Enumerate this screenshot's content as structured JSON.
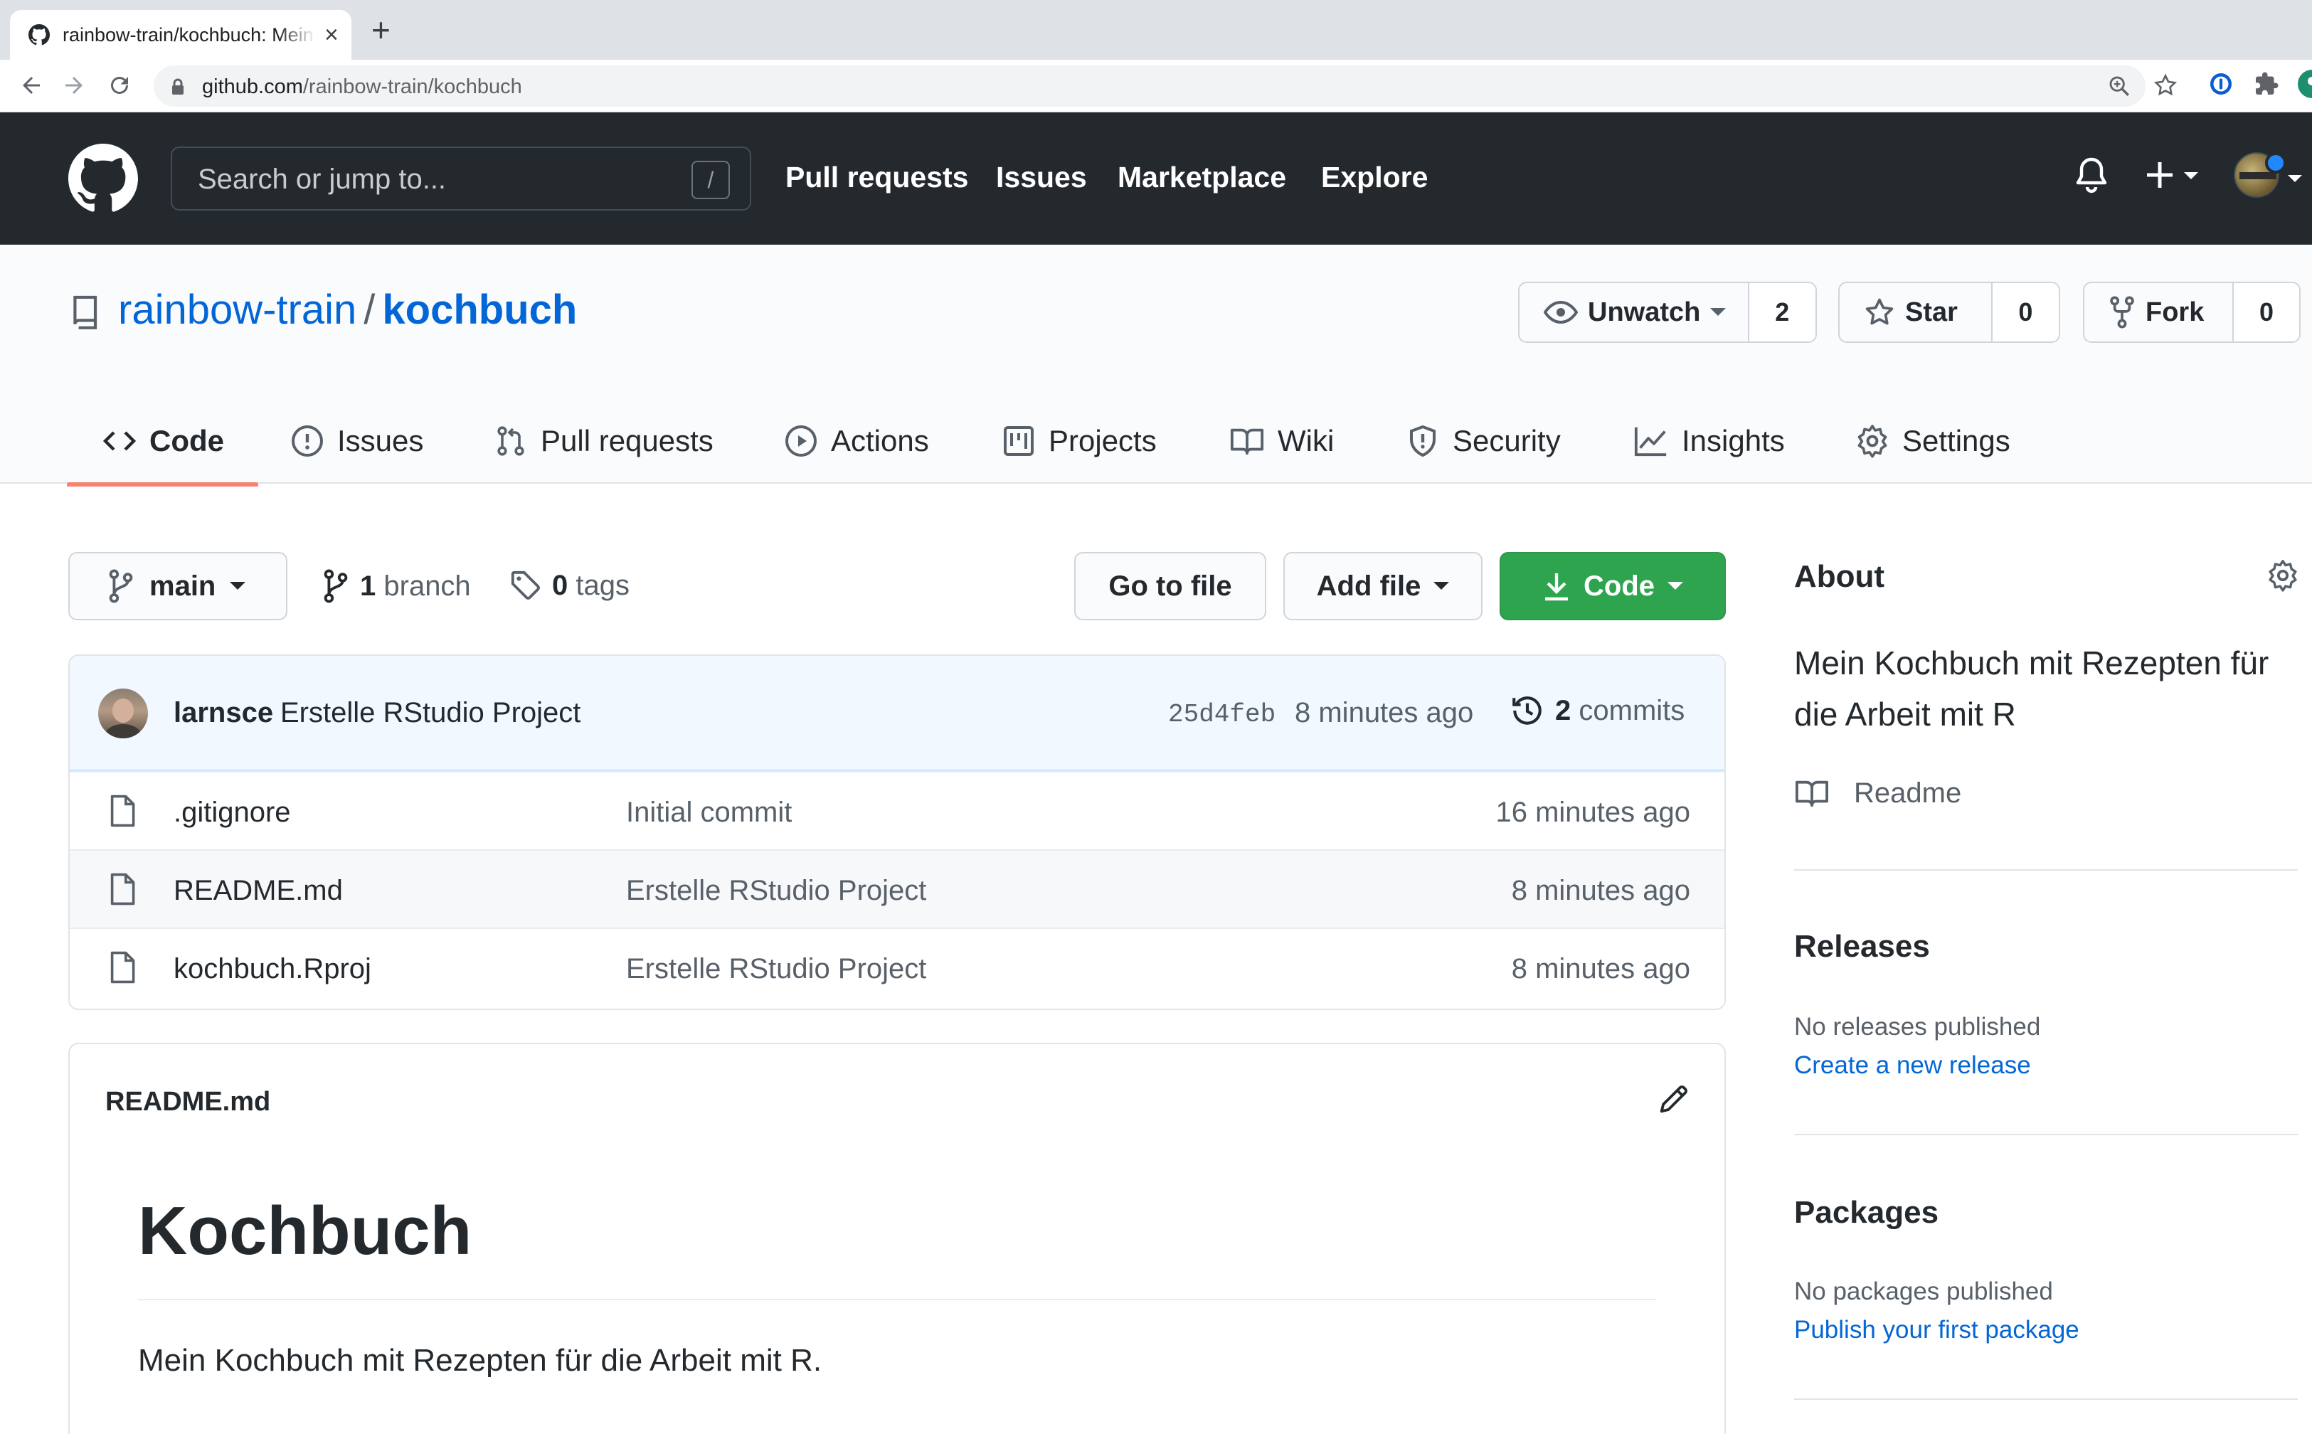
{
  "browser": {
    "tab_title": "rainbow-train/kochbuch: Mein Kochbuch mit Rezepten für die Arbeit mit R",
    "url_host": "github.com",
    "url_path": "/rainbow-train/kochbuch"
  },
  "header": {
    "search_placeholder": "Search or jump to...",
    "search_shortcut": "/",
    "nav": [
      "Pull requests",
      "Issues",
      "Marketplace",
      "Explore"
    ]
  },
  "repo": {
    "owner": "rainbow-train",
    "separator": "/",
    "name": "kochbuch",
    "watch_label": "Unwatch",
    "watch_count": "2",
    "star_label": "Star",
    "star_count": "0",
    "fork_label": "Fork",
    "fork_count": "0"
  },
  "tabs": [
    {
      "label": "Code",
      "icon": "code-icon",
      "selected": true
    },
    {
      "label": "Issues",
      "icon": "issue-icon"
    },
    {
      "label": "Pull requests",
      "icon": "pull-request-icon"
    },
    {
      "label": "Actions",
      "icon": "play-icon"
    },
    {
      "label": "Projects",
      "icon": "project-icon"
    },
    {
      "label": "Wiki",
      "icon": "book-icon"
    },
    {
      "label": "Security",
      "icon": "shield-icon"
    },
    {
      "label": "Insights",
      "icon": "graph-icon"
    },
    {
      "label": "Settings",
      "icon": "gear-icon"
    }
  ],
  "toolbar": {
    "branch": "main",
    "branch_count": "1",
    "branch_word": "branch",
    "tag_count": "0",
    "tag_word": "tags",
    "goto_file": "Go to file",
    "add_file": "Add file",
    "code": "Code"
  },
  "commit": {
    "author": "larnsce",
    "message": "Erstelle RStudio Project",
    "sha": "25d4feb",
    "age": "8 minutes ago",
    "count": "2",
    "count_word": "commits"
  },
  "files": [
    {
      "name": ".gitignore",
      "message": "Initial commit",
      "age": "16 minutes ago"
    },
    {
      "name": "README.md",
      "message": "Erstelle RStudio Project",
      "age": "8 minutes ago"
    },
    {
      "name": "kochbuch.Rproj",
      "message": "Erstelle RStudio Project",
      "age": "8 minutes ago"
    }
  ],
  "readme": {
    "title": "README.md",
    "heading": "Kochbuch",
    "body": "Mein Kochbuch mit Rezepten für die Arbeit mit R."
  },
  "sidebar": {
    "about_title": "About",
    "description": "Mein Kochbuch mit Rezepten für die Arbeit mit R",
    "readme_link": "Readme",
    "releases_title": "Releases",
    "releases_note": "No releases published",
    "releases_link": "Create a new release",
    "packages_title": "Packages",
    "packages_note": "No packages published",
    "packages_link": "Publish your first package"
  },
  "colors": {
    "header_bg": "#24292e",
    "link": "#0366d6",
    "primary_button": "#2ea44f",
    "selected_tab_underline": "#f9826c",
    "commit_bar_bg": "#f1f8ff"
  }
}
